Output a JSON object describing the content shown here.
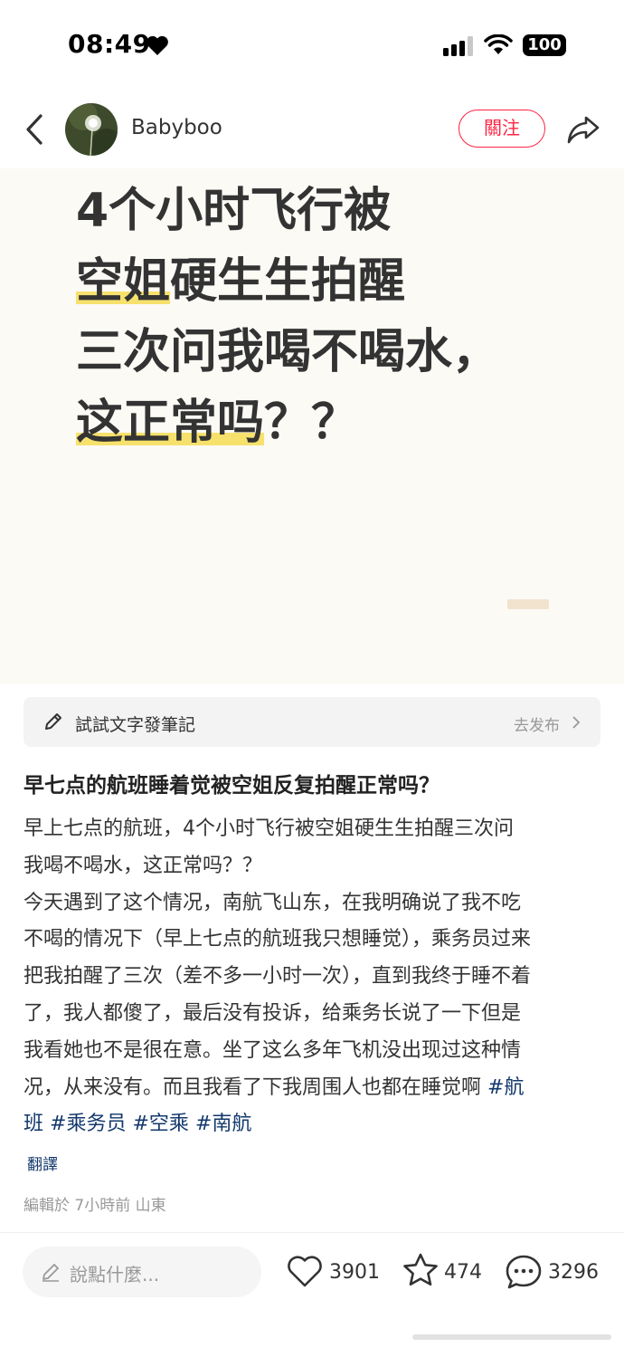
{
  "status_bar": {
    "time": "08:49",
    "battery": "100"
  },
  "header": {
    "username": "Babyboo",
    "follow_label": "關注"
  },
  "cover": {
    "lines": [
      "4个小时飞行被",
      "空姐",
      "硬生生拍醒",
      "三次问我喝不喝水，",
      "这正常吗",
      "？？"
    ]
  },
  "note_prompt": {
    "label": "試試文字發筆記",
    "action": "去发布"
  },
  "post": {
    "title": "早七点的航班睡着觉被空姐反复拍醒正常吗？",
    "body_lines": [
      "早上七点的航班，4个小时飞行被空姐硬生生拍醒三次问",
      "我喝不喝水，这正常吗？？",
      "今天遇到了这个情况，南航飞山东，在我明确说了我不吃",
      "不喝的情况下（早上七点的航班我只想睡觉），乘务员过来",
      "把我拍醒了三次（差不多一小时一次），直到我终于睡不着",
      "了，我人都傻了，最后没有投诉，给乘务长说了一下但是",
      "我看她也不是很在意。坐了这么多年飞机没出现过这种情",
      "况，从来没有。而且我看了下我周围人也都在睡觉啊"
    ],
    "tags": [
      "#航",
      "班",
      "#乘务员",
      "#空乘",
      "#南航"
    ],
    "translate_label": "翻譯",
    "meta": "編輯於 7小時前 山東"
  },
  "bottom_bar": {
    "comment_placeholder": "說點什麼...",
    "likes": "3901",
    "collects": "474",
    "comments": "3296"
  },
  "colors": {
    "accent": "#ff2442",
    "tag": "#13386c",
    "highlight": "#f7e16d"
  },
  "icons": [
    "heart-icon",
    "signal-icon",
    "wifi-icon",
    "back-icon",
    "share-icon",
    "pencil-icon",
    "chevron-right-icon",
    "like-icon",
    "star-icon",
    "comment-icon"
  ]
}
